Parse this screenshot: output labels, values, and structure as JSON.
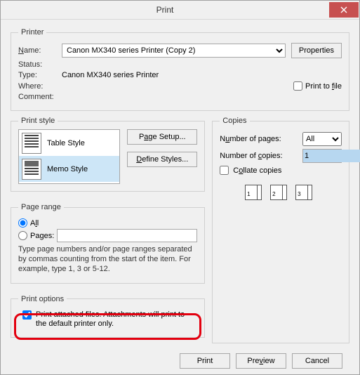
{
  "title": "Print",
  "printer": {
    "legend": "Printer",
    "name_label": "Name:",
    "name_value": "Canon MX340 series Printer (Copy 2)",
    "properties_btn": "Properties",
    "status_label": "Status:",
    "status_value": "",
    "type_label": "Type:",
    "type_value": "Canon MX340 series Printer",
    "where_label": "Where:",
    "where_value": "",
    "comment_label": "Comment:",
    "comment_value": "",
    "print_to_file_label": "Print to file"
  },
  "print_style": {
    "legend": "Print style",
    "items": {
      "table": "Table Style",
      "memo": "Memo Style"
    },
    "page_setup_btn": "Page Setup...",
    "define_styles_btn": "Define Styles..."
  },
  "copies": {
    "legend": "Copies",
    "num_pages_label": "Number of pages:",
    "num_pages_value": "All",
    "num_copies_label": "Number of copies:",
    "num_copies_value": "1",
    "collate_label": "Collate copies"
  },
  "page_range": {
    "legend": "Page range",
    "all_label": "All",
    "pages_label": "Pages:",
    "pages_value": "",
    "hint": "Type page numbers and/or page ranges separated by commas counting from the start of the item.  For example, type 1, 3 or 5-12."
  },
  "print_options": {
    "legend": "Print options",
    "attach_label": "Print attached files.  Attachments will print to the default printer only."
  },
  "footer": {
    "print": "Print",
    "preview": "Preview",
    "cancel": "Cancel"
  }
}
